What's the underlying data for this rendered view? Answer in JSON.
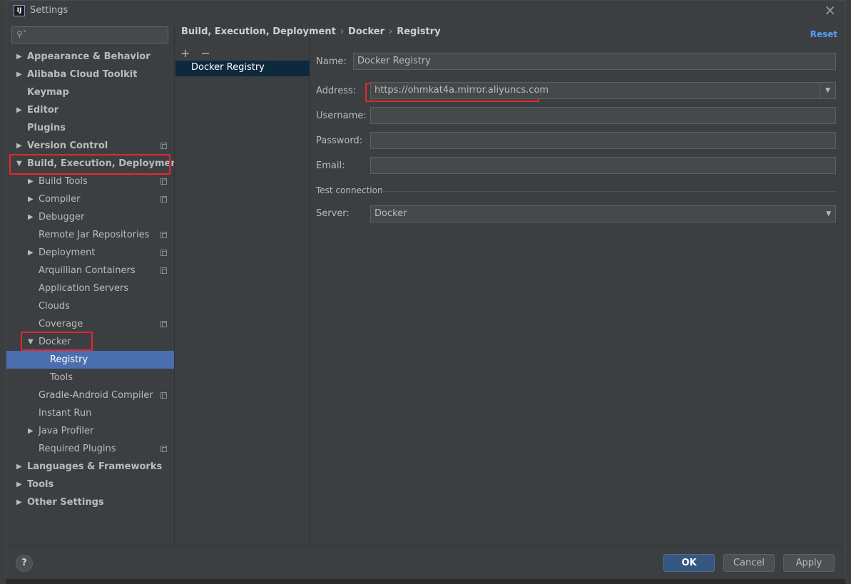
{
  "window": {
    "title": "Settings",
    "app_icon": "IJ"
  },
  "search": {
    "placeholder": ""
  },
  "sidebar": {
    "items": [
      {
        "label": "Appearance & Behavior",
        "expanded": false
      },
      {
        "label": "Alibaba Cloud Toolkit",
        "expanded": false
      },
      {
        "label": "Keymap"
      },
      {
        "label": "Editor",
        "expanded": false
      },
      {
        "label": "Plugins"
      },
      {
        "label": "Version Control",
        "expanded": false
      },
      {
        "label": "Build, Execution, Deployment",
        "expanded": true
      },
      {
        "label": "Build Tools"
      },
      {
        "label": "Compiler"
      },
      {
        "label": "Debugger"
      },
      {
        "label": "Remote Jar Repositories"
      },
      {
        "label": "Deployment"
      },
      {
        "label": "Arquillian Containers"
      },
      {
        "label": "Application Servers"
      },
      {
        "label": "Clouds"
      },
      {
        "label": "Coverage"
      },
      {
        "label": "Docker",
        "expanded": true
      },
      {
        "label": "Registry",
        "selected": true
      },
      {
        "label": "Tools"
      },
      {
        "label": "Gradle-Android Compiler"
      },
      {
        "label": "Instant Run"
      },
      {
        "label": "Java Profiler"
      },
      {
        "label": "Required Plugins"
      },
      {
        "label": "Languages & Frameworks"
      },
      {
        "label": "Tools"
      },
      {
        "label": "Other Settings"
      }
    ]
  },
  "breadcrumb": {
    "parts": [
      "Build, Execution, Deployment",
      "Docker",
      "Registry"
    ],
    "separator": "›"
  },
  "reset_label": "Reset",
  "middle": {
    "add": "+",
    "remove": "−",
    "items": [
      "Docker Registry"
    ]
  },
  "form": {
    "name_label": "Name:",
    "name_value": "Docker Registry",
    "address_label": "Address:",
    "address_value": "https://ohmkat4a.mirror.aliyuncs.com",
    "username_label": "Username:",
    "username_value": "",
    "password_label": "Password:",
    "password_value": "",
    "email_label": "Email:",
    "email_value": "",
    "test_section": "Test connection",
    "server_label": "Server:",
    "server_value": "Docker"
  },
  "buttons": {
    "help": "?",
    "ok": "OK",
    "cancel": "Cancel",
    "apply": "Apply"
  },
  "colors": {
    "selection": "#4b6eaf",
    "highlight": "#e8262c",
    "link": "#589df6",
    "primary_button": "#365880"
  }
}
